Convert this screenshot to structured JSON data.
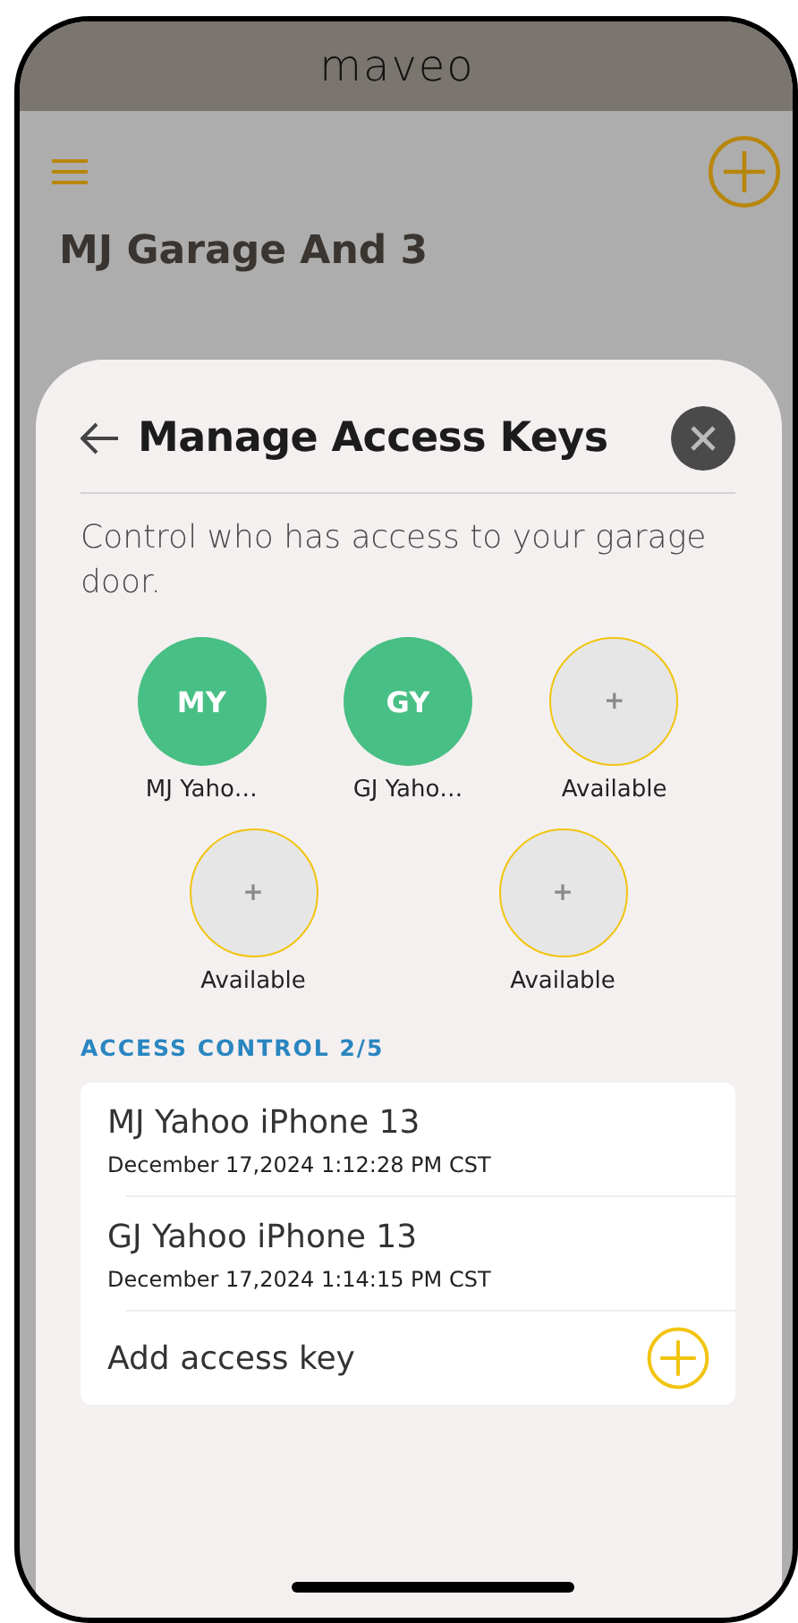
{
  "app_bar": {
    "logo": "maveo"
  },
  "garage": {
    "title": "MJ Garage And 3"
  },
  "sheet": {
    "title": "Manage Access Keys",
    "description": "Control who has access to your garage door.",
    "slots": [
      {
        "kind": "user",
        "initials": "MY",
        "label": "MJ Yaho…"
      },
      {
        "kind": "user",
        "initials": "GY",
        "label": "GJ Yaho…"
      },
      {
        "kind": "empty",
        "initials": "+",
        "label": "Available"
      },
      {
        "kind": "empty",
        "initials": "+",
        "label": "Available"
      },
      {
        "kind": "empty",
        "initials": "+",
        "label": "Available"
      }
    ],
    "section_label": "ACCESS CONTROL 2/5",
    "keys": [
      {
        "name": "MJ Yahoo iPhone 13",
        "date": "December 17,2024 1:12:28 PM CST"
      },
      {
        "name": "GJ Yahoo iPhone 13",
        "date": "December 17,2024 1:14:15 PM CST"
      }
    ],
    "add_label": "Add access key"
  }
}
